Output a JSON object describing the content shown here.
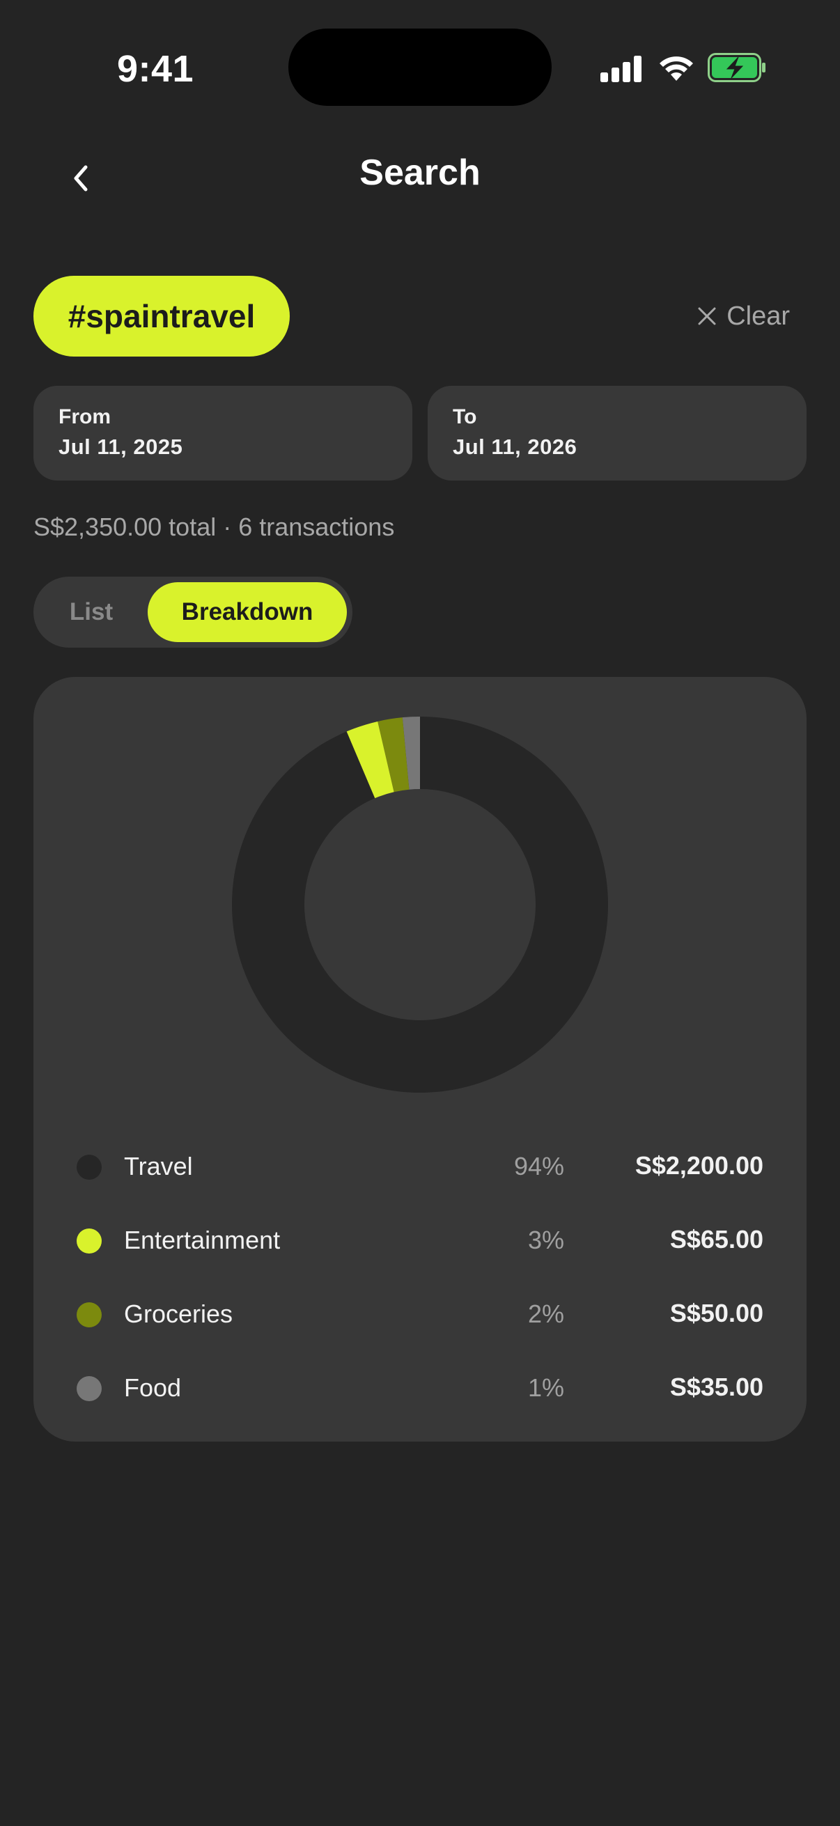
{
  "status": {
    "time": "9:41"
  },
  "nav": {
    "title": "Search"
  },
  "tag": {
    "label": "#spaintravel"
  },
  "clear": {
    "label": "Clear"
  },
  "dates": {
    "from": {
      "label": "From",
      "value": "Jul 11, 2025"
    },
    "to": {
      "label": "To",
      "value": "Jul 11, 2026"
    }
  },
  "summary": "S$2,350.00 total · 6 transactions",
  "segments": {
    "list": "List",
    "breakdown": "Breakdown",
    "active": "Breakdown"
  },
  "colors": {
    "background": "#242424",
    "card": "#383838",
    "accent": "#d9f22c",
    "travel": "#262626",
    "entertainment": "#d9f22c",
    "groceries": "#7c8a0e",
    "food": "#777777"
  },
  "chart_data": {
    "type": "pie",
    "categories": [
      "Travel",
      "Entertainment",
      "Groceries",
      "Food"
    ],
    "values": [
      2200,
      65,
      50,
      35
    ],
    "percents": [
      "94%",
      "3%",
      "2%",
      "1%"
    ],
    "amounts": [
      "S$2,200.00",
      "S$65.00",
      "S$50.00",
      "S$35.00"
    ],
    "colors": [
      "#262626",
      "#d9f22c",
      "#7c8a0e",
      "#777777"
    ],
    "donut": true
  }
}
